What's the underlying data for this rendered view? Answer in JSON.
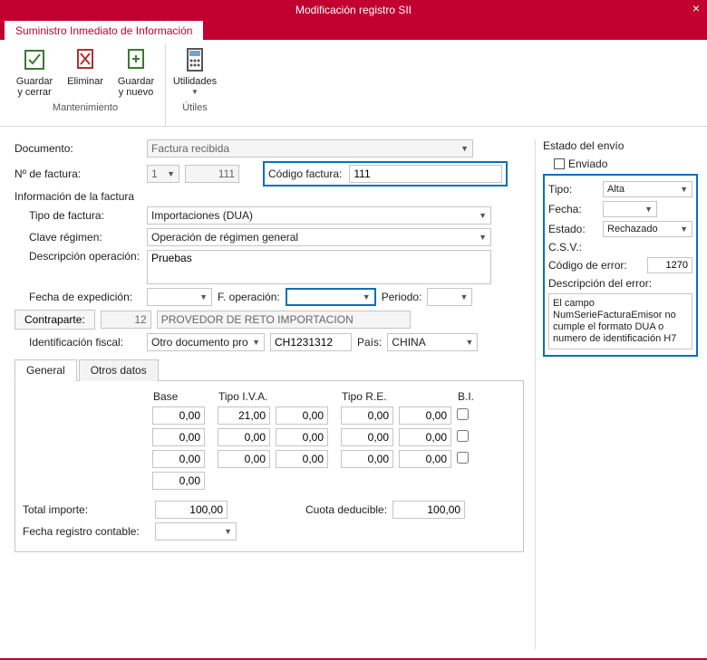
{
  "window": {
    "title": "Modificación registro SII",
    "tab_label": "Suministro Inmediato de Información"
  },
  "ribbon": {
    "group_maint_label": "Mantenimiento",
    "group_util_label": "Útiles",
    "buttons": {
      "save_close": "Guardar y cerrar",
      "delete": "Eliminar",
      "save_new": "Guardar y nuevo",
      "utilities": "Utilidades"
    }
  },
  "form": {
    "documento_label": "Documento:",
    "documento_value": "Factura recibida",
    "nfactura_label": "Nº de factura:",
    "nfactura_serie": "1",
    "nfactura_num": "111",
    "codigo_factura_label": "Código factura:",
    "codigo_factura_value": "111",
    "info_title": "Información de la factura",
    "tipo_factura_label": "Tipo de factura:",
    "tipo_factura_value": "Importaciones (DUA)",
    "clave_regimen_label": "Clave régimen:",
    "clave_regimen_value": "Operación de régimen general",
    "desc_op_label": "Descripción operación:",
    "desc_op_value": "Pruebas",
    "fecha_exp_label": "Fecha de expedición:",
    "fecha_exp_value": "",
    "f_operacion_label": "F. operación:",
    "f_operacion_value": "",
    "periodo_label": "Periodo:",
    "periodo_value": "",
    "contraparte_btn": "Contraparte:",
    "contraparte_code": "12",
    "contraparte_name": "PROVEDOR DE RETO IMPORTACION",
    "ident_fiscal_label": "Identificación fiscal:",
    "ident_fiscal_tipo": "Otro documento prob",
    "ident_fiscal_num": "CH1231312",
    "pais_label": "País:",
    "pais_value": "CHINA"
  },
  "tabs": {
    "general": "General",
    "otros": "Otros datos"
  },
  "grid": {
    "headers": {
      "base": "Base",
      "tipo_iva": "Tipo I.V.A.",
      "tipo_re": "Tipo R.E.",
      "bi": "B.I."
    },
    "rows": [
      {
        "base": "0,00",
        "tiva_pct": "21,00",
        "tiva_cuota": "0,00",
        "tre_pct": "0,00",
        "tre_cuota": "0,00",
        "bi": false
      },
      {
        "base": "0,00",
        "tiva_pct": "0,00",
        "tiva_cuota": "0,00",
        "tre_pct": "0,00",
        "tre_cuota": "0,00",
        "bi": false
      },
      {
        "base": "0,00",
        "tiva_pct": "0,00",
        "tiva_cuota": "0,00",
        "tre_pct": "0,00",
        "tre_cuota": "0,00",
        "bi": false
      }
    ],
    "extra_base": "0,00",
    "total_label": "Total importe:",
    "total_value": "100,00",
    "cuota_label": "Cuota deducible:",
    "cuota_value": "100,00",
    "freg_label": "Fecha registro contable:",
    "freg_value": ""
  },
  "side": {
    "title": "Estado del envío",
    "enviado_label": "Enviado",
    "enviado": false,
    "tipo_label": "Tipo:",
    "tipo_value": "Alta",
    "fecha_label": "Fecha:",
    "fecha_value": "",
    "estado_label": "Estado:",
    "estado_value": "Rechazado",
    "csv_label": "C.S.V.:",
    "coderr_label": "Código de error:",
    "coderr_value": "1270",
    "descerr_label": "Descripción del error:",
    "descerr_value": "El campo NumSerieFacturaEmisor no cumple el formato DUA o numero de identificación H7"
  }
}
